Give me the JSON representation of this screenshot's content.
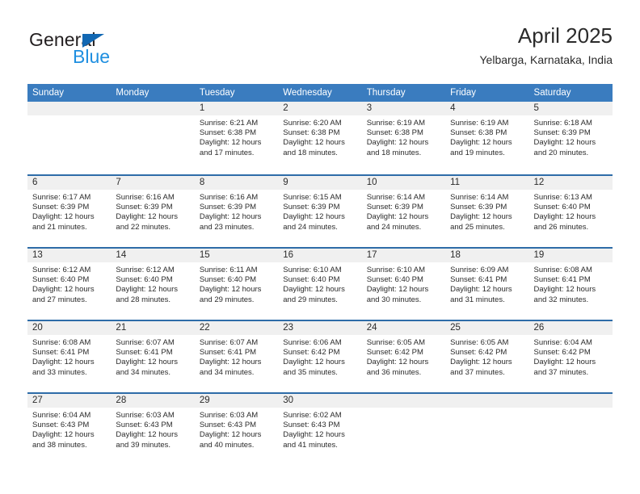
{
  "brand": {
    "name_top": "General",
    "name_bottom": "Blue",
    "accent_dark": "#1268b3",
    "accent_light": "#1f8fe0"
  },
  "header": {
    "title": "April 2025",
    "subtitle": "Yelbarga, Karnataka, India"
  },
  "theme": {
    "header_blue": "#3a7cbf",
    "row_divider_blue": "#2e6ca8",
    "datestrip_gray": "#f0f0f0",
    "text": "#2b2b2b"
  },
  "calendar": {
    "weekdays": [
      "Sunday",
      "Monday",
      "Tuesday",
      "Wednesday",
      "Thursday",
      "Friday",
      "Saturday"
    ],
    "weeks": [
      [
        {
          "day": "",
          "sunrise": "",
          "sunset": "",
          "daylight_line1": "",
          "daylight_line2": ""
        },
        {
          "day": "",
          "sunrise": "",
          "sunset": "",
          "daylight_line1": "",
          "daylight_line2": ""
        },
        {
          "day": "1",
          "sunrise": "Sunrise: 6:21 AM",
          "sunset": "Sunset: 6:38 PM",
          "daylight_line1": "Daylight: 12 hours",
          "daylight_line2": "and 17 minutes."
        },
        {
          "day": "2",
          "sunrise": "Sunrise: 6:20 AM",
          "sunset": "Sunset: 6:38 PM",
          "daylight_line1": "Daylight: 12 hours",
          "daylight_line2": "and 18 minutes."
        },
        {
          "day": "3",
          "sunrise": "Sunrise: 6:19 AM",
          "sunset": "Sunset: 6:38 PM",
          "daylight_line1": "Daylight: 12 hours",
          "daylight_line2": "and 18 minutes."
        },
        {
          "day": "4",
          "sunrise": "Sunrise: 6:19 AM",
          "sunset": "Sunset: 6:38 PM",
          "daylight_line1": "Daylight: 12 hours",
          "daylight_line2": "and 19 minutes."
        },
        {
          "day": "5",
          "sunrise": "Sunrise: 6:18 AM",
          "sunset": "Sunset: 6:39 PM",
          "daylight_line1": "Daylight: 12 hours",
          "daylight_line2": "and 20 minutes."
        }
      ],
      [
        {
          "day": "6",
          "sunrise": "Sunrise: 6:17 AM",
          "sunset": "Sunset: 6:39 PM",
          "daylight_line1": "Daylight: 12 hours",
          "daylight_line2": "and 21 minutes."
        },
        {
          "day": "7",
          "sunrise": "Sunrise: 6:16 AM",
          "sunset": "Sunset: 6:39 PM",
          "daylight_line1": "Daylight: 12 hours",
          "daylight_line2": "and 22 minutes."
        },
        {
          "day": "8",
          "sunrise": "Sunrise: 6:16 AM",
          "sunset": "Sunset: 6:39 PM",
          "daylight_line1": "Daylight: 12 hours",
          "daylight_line2": "and 23 minutes."
        },
        {
          "day": "9",
          "sunrise": "Sunrise: 6:15 AM",
          "sunset": "Sunset: 6:39 PM",
          "daylight_line1": "Daylight: 12 hours",
          "daylight_line2": "and 24 minutes."
        },
        {
          "day": "10",
          "sunrise": "Sunrise: 6:14 AM",
          "sunset": "Sunset: 6:39 PM",
          "daylight_line1": "Daylight: 12 hours",
          "daylight_line2": "and 24 minutes."
        },
        {
          "day": "11",
          "sunrise": "Sunrise: 6:14 AM",
          "sunset": "Sunset: 6:39 PM",
          "daylight_line1": "Daylight: 12 hours",
          "daylight_line2": "and 25 minutes."
        },
        {
          "day": "12",
          "sunrise": "Sunrise: 6:13 AM",
          "sunset": "Sunset: 6:40 PM",
          "daylight_line1": "Daylight: 12 hours",
          "daylight_line2": "and 26 minutes."
        }
      ],
      [
        {
          "day": "13",
          "sunrise": "Sunrise: 6:12 AM",
          "sunset": "Sunset: 6:40 PM",
          "daylight_line1": "Daylight: 12 hours",
          "daylight_line2": "and 27 minutes."
        },
        {
          "day": "14",
          "sunrise": "Sunrise: 6:12 AM",
          "sunset": "Sunset: 6:40 PM",
          "daylight_line1": "Daylight: 12 hours",
          "daylight_line2": "and 28 minutes."
        },
        {
          "day": "15",
          "sunrise": "Sunrise: 6:11 AM",
          "sunset": "Sunset: 6:40 PM",
          "daylight_line1": "Daylight: 12 hours",
          "daylight_line2": "and 29 minutes."
        },
        {
          "day": "16",
          "sunrise": "Sunrise: 6:10 AM",
          "sunset": "Sunset: 6:40 PM",
          "daylight_line1": "Daylight: 12 hours",
          "daylight_line2": "and 29 minutes."
        },
        {
          "day": "17",
          "sunrise": "Sunrise: 6:10 AM",
          "sunset": "Sunset: 6:40 PM",
          "daylight_line1": "Daylight: 12 hours",
          "daylight_line2": "and 30 minutes."
        },
        {
          "day": "18",
          "sunrise": "Sunrise: 6:09 AM",
          "sunset": "Sunset: 6:41 PM",
          "daylight_line1": "Daylight: 12 hours",
          "daylight_line2": "and 31 minutes."
        },
        {
          "day": "19",
          "sunrise": "Sunrise: 6:08 AM",
          "sunset": "Sunset: 6:41 PM",
          "daylight_line1": "Daylight: 12 hours",
          "daylight_line2": "and 32 minutes."
        }
      ],
      [
        {
          "day": "20",
          "sunrise": "Sunrise: 6:08 AM",
          "sunset": "Sunset: 6:41 PM",
          "daylight_line1": "Daylight: 12 hours",
          "daylight_line2": "and 33 minutes."
        },
        {
          "day": "21",
          "sunrise": "Sunrise: 6:07 AM",
          "sunset": "Sunset: 6:41 PM",
          "daylight_line1": "Daylight: 12 hours",
          "daylight_line2": "and 34 minutes."
        },
        {
          "day": "22",
          "sunrise": "Sunrise: 6:07 AM",
          "sunset": "Sunset: 6:41 PM",
          "daylight_line1": "Daylight: 12 hours",
          "daylight_line2": "and 34 minutes."
        },
        {
          "day": "23",
          "sunrise": "Sunrise: 6:06 AM",
          "sunset": "Sunset: 6:42 PM",
          "daylight_line1": "Daylight: 12 hours",
          "daylight_line2": "and 35 minutes."
        },
        {
          "day": "24",
          "sunrise": "Sunrise: 6:05 AM",
          "sunset": "Sunset: 6:42 PM",
          "daylight_line1": "Daylight: 12 hours",
          "daylight_line2": "and 36 minutes."
        },
        {
          "day": "25",
          "sunrise": "Sunrise: 6:05 AM",
          "sunset": "Sunset: 6:42 PM",
          "daylight_line1": "Daylight: 12 hours",
          "daylight_line2": "and 37 minutes."
        },
        {
          "day": "26",
          "sunrise": "Sunrise: 6:04 AM",
          "sunset": "Sunset: 6:42 PM",
          "daylight_line1": "Daylight: 12 hours",
          "daylight_line2": "and 37 minutes."
        }
      ],
      [
        {
          "day": "27",
          "sunrise": "Sunrise: 6:04 AM",
          "sunset": "Sunset: 6:43 PM",
          "daylight_line1": "Daylight: 12 hours",
          "daylight_line2": "and 38 minutes."
        },
        {
          "day": "28",
          "sunrise": "Sunrise: 6:03 AM",
          "sunset": "Sunset: 6:43 PM",
          "daylight_line1": "Daylight: 12 hours",
          "daylight_line2": "and 39 minutes."
        },
        {
          "day": "29",
          "sunrise": "Sunrise: 6:03 AM",
          "sunset": "Sunset: 6:43 PM",
          "daylight_line1": "Daylight: 12 hours",
          "daylight_line2": "and 40 minutes."
        },
        {
          "day": "30",
          "sunrise": "Sunrise: 6:02 AM",
          "sunset": "Sunset: 6:43 PM",
          "daylight_line1": "Daylight: 12 hours",
          "daylight_line2": "and 41 minutes."
        },
        {
          "day": "",
          "sunrise": "",
          "sunset": "",
          "daylight_line1": "",
          "daylight_line2": ""
        },
        {
          "day": "",
          "sunrise": "",
          "sunset": "",
          "daylight_line1": "",
          "daylight_line2": ""
        },
        {
          "day": "",
          "sunrise": "",
          "sunset": "",
          "daylight_line1": "",
          "daylight_line2": ""
        }
      ]
    ]
  }
}
